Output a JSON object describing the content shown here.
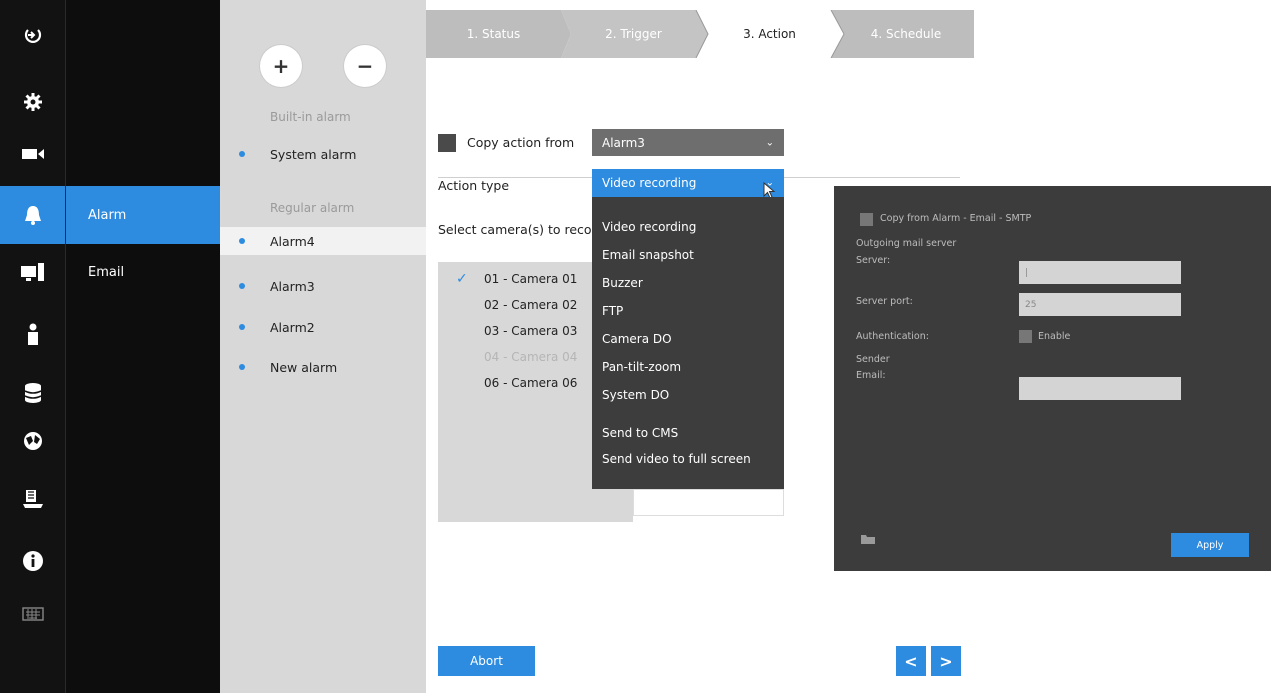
{
  "rail": {
    "items": [
      {
        "icon": "logout-icon"
      },
      {
        "icon": "gear-icon"
      },
      {
        "icon": "camera-icon"
      },
      {
        "icon": "bell-icon"
      },
      {
        "icon": "device-icon"
      },
      {
        "icon": "user-icon"
      },
      {
        "icon": "database-icon"
      },
      {
        "icon": "network-icon"
      },
      {
        "icon": "globe-icon"
      },
      {
        "icon": "info-icon"
      },
      {
        "icon": "keyboard-icon"
      }
    ]
  },
  "submenu": {
    "items": [
      "Alarm",
      "Email"
    ]
  },
  "alarm_list": {
    "add_label": "+",
    "remove_label": "−",
    "builtin_heading": "Built-in alarm",
    "builtin_items": [
      "System alarm"
    ],
    "regular_heading": "Regular alarm",
    "regular_items": [
      "Alarm4",
      "Alarm3",
      "Alarm2",
      "New alarm"
    ]
  },
  "steps": {
    "items": [
      "1. Status",
      "2. Trigger",
      "3. Action",
      "4. Schedule"
    ],
    "active_index": 2
  },
  "action": {
    "copy_label": "Copy action from",
    "copy_select_value": "Alarm3",
    "action_type_label": "Action type",
    "action_type_value": "Video recording",
    "select_cameras_label": "Select camera(s) to record",
    "cameras": [
      {
        "name": "01 - Camera 01",
        "checked": true,
        "disabled": false
      },
      {
        "name": "02 - Camera 02",
        "checked": false,
        "disabled": false
      },
      {
        "name": "03 - Camera 03",
        "checked": false,
        "disabled": false
      },
      {
        "name": "04 - Camera 04",
        "checked": false,
        "disabled": true
      },
      {
        "name": "06 - Camera 06",
        "checked": false,
        "disabled": false
      }
    ],
    "action_options": [
      "Video recording",
      "Email snapshot",
      "Buzzer",
      "FTP",
      "Camera DO",
      "Pan-tilt-zoom",
      "System DO",
      "Send to CMS",
      "Send video to full screen"
    ],
    "abort_label": "Abort",
    "prev_label": "<",
    "next_label": ">"
  },
  "email_panel": {
    "copy_label": "Copy from Alarm - Email - SMTP",
    "outgoing_label": "Outgoing mail server",
    "server_label": "Server:",
    "server_value": "|",
    "port_label": "Server port:",
    "port_value": "25",
    "auth_label": "Authentication:",
    "enable_label": "Enable",
    "sender_label": "Sender",
    "email_label": "Email:",
    "email_value": "",
    "apply_label": "Apply"
  },
  "colors": {
    "accent": "#2d8be0",
    "rail_bg": "#121212",
    "panel_bg": "#d8d8d8",
    "overlay_bg": "#3c3c3c"
  }
}
